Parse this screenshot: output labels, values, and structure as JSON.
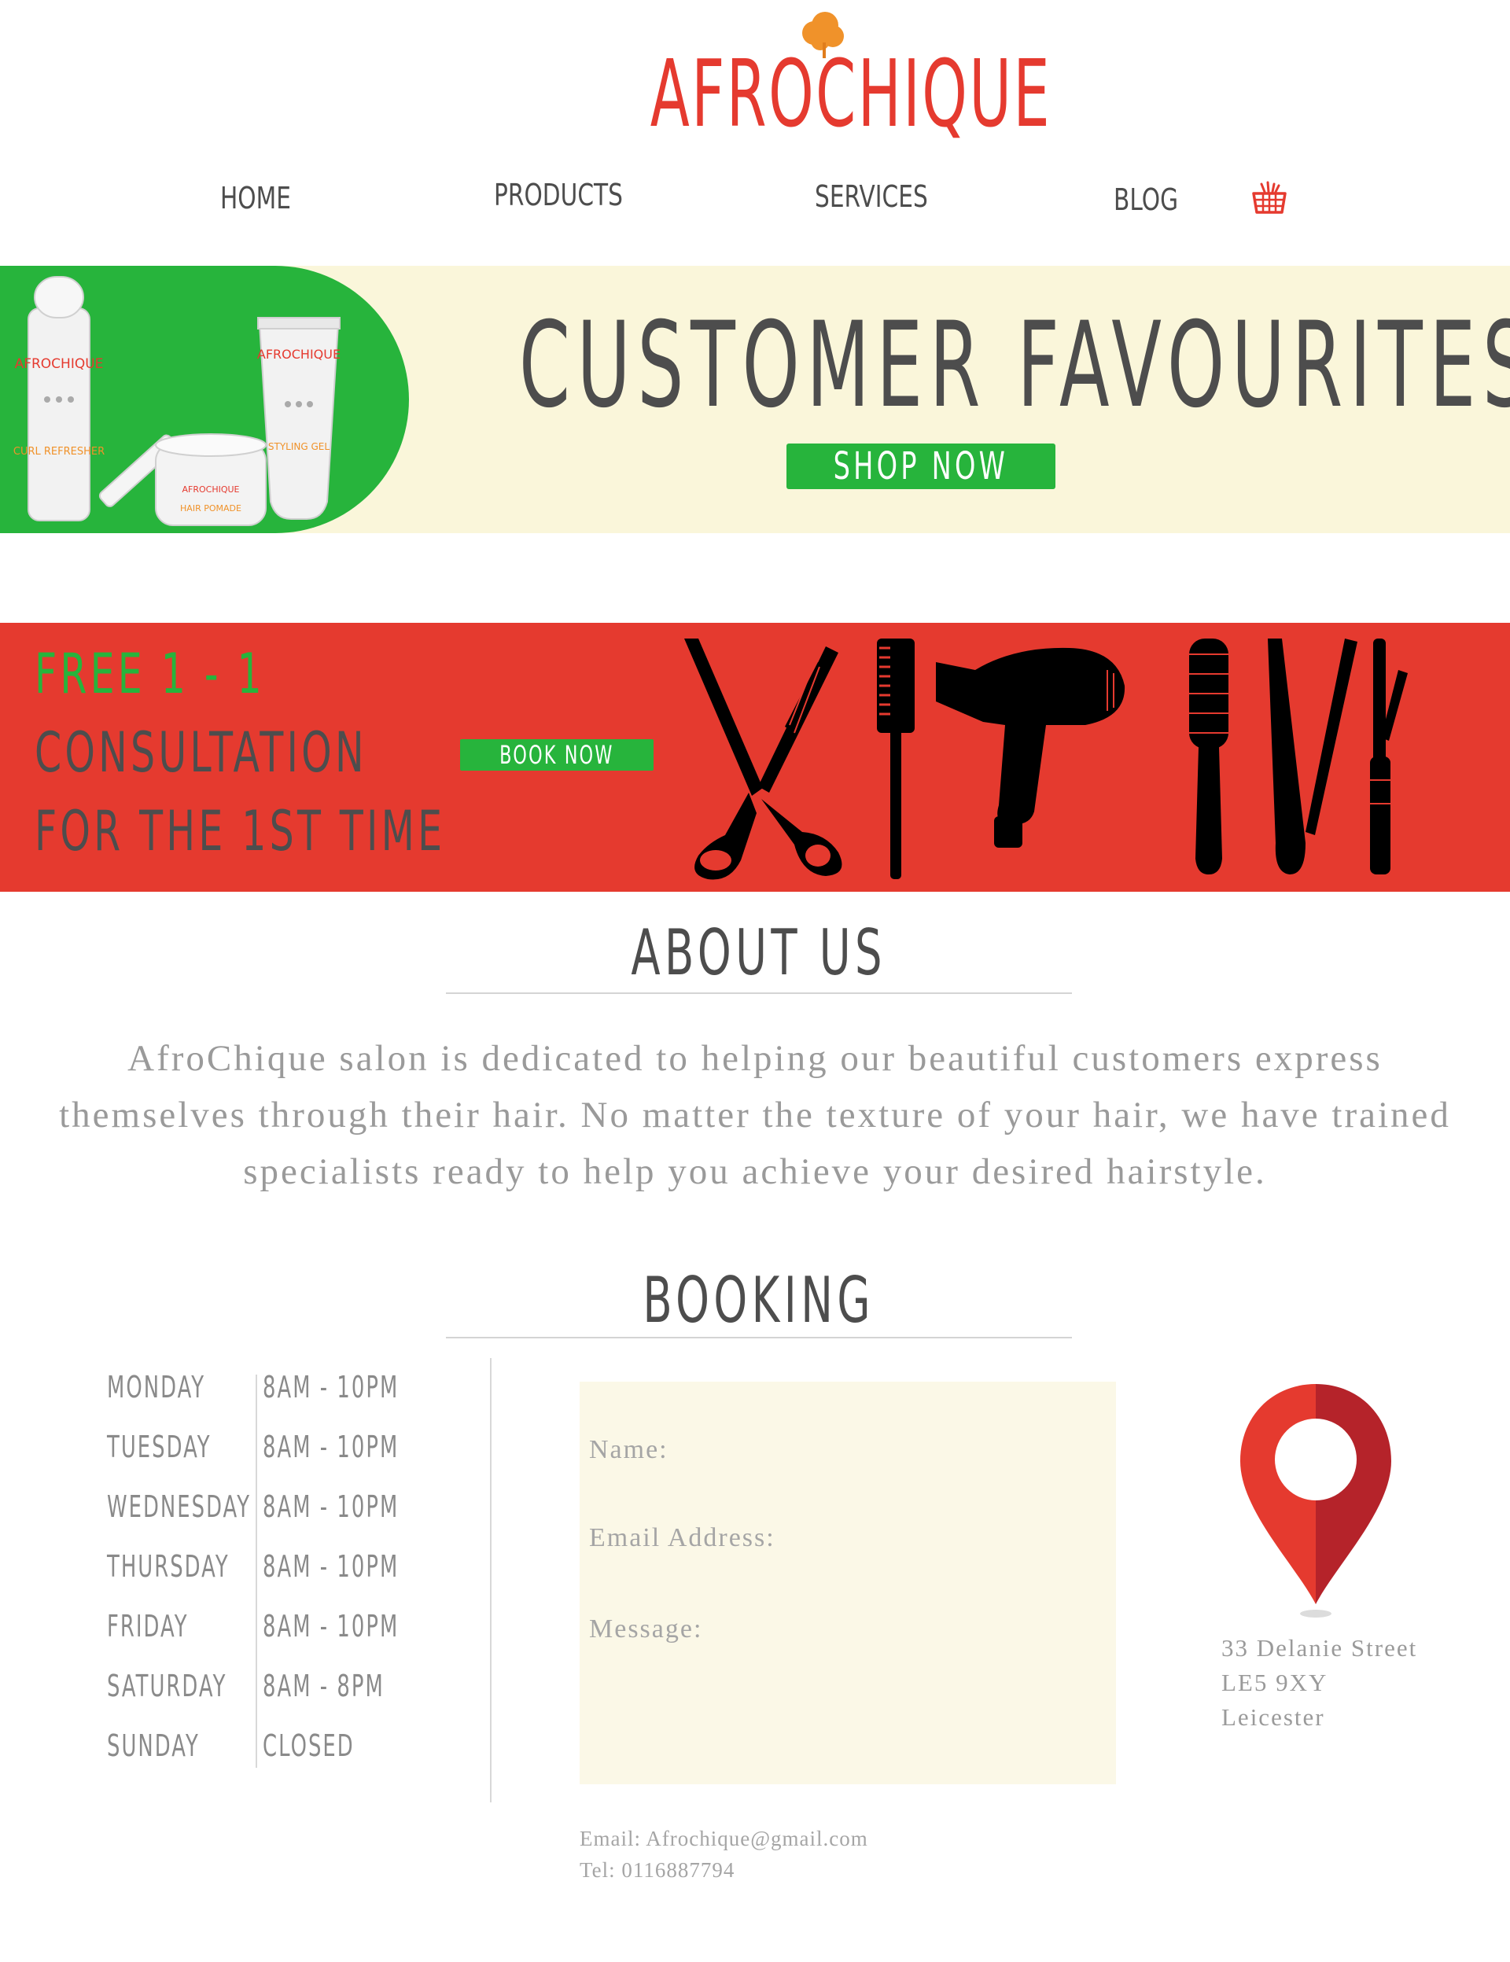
{
  "brand": {
    "name": "AFROCHIQUE",
    "logo_color": "#e53a2f",
    "tree_color": "#f0922a"
  },
  "nav": {
    "items": [
      {
        "label": "HOME"
      },
      {
        "label": "PRODUCTS"
      },
      {
        "label": "SERVICES"
      },
      {
        "label": "BLOG"
      }
    ],
    "cart_icon": "shopping-basket-icon"
  },
  "promo": {
    "title": "CUSTOMER FAVOURITES",
    "button": "SHOP NOW",
    "products": [
      {
        "brand": "AFROCHIQUE",
        "name": "CURL REFRESHER"
      },
      {
        "brand": "AFROCHIQUE",
        "name": "HAIR POMADE"
      },
      {
        "brand": "AFROCHIQUE",
        "name": "STYLING GEL"
      }
    ]
  },
  "consultation": {
    "line1": "FREE 1 - 1",
    "line2": "CONSULTATION",
    "line3": "FOR THE 1ST TIME",
    "button": "BOOK NOW",
    "tools": [
      "scissors-icon",
      "comb-icon",
      "hair-dryer-icon",
      "round-brush-icon",
      "straightener-icon",
      "curling-iron-icon"
    ]
  },
  "about": {
    "title": "ABOUT US",
    "text": "AfroChique salon is dedicated to helping our beautiful customers express themselves through their hair. No matter the texture of your hair,  we have trained specialists ready to help you achieve your desired hairstyle."
  },
  "booking": {
    "title": "BOOKING",
    "hours": [
      {
        "day": "MONDAY",
        "time": "8AM - 10PM"
      },
      {
        "day": "TUESDAY",
        "time": "8AM - 10PM"
      },
      {
        "day": "WEDNESDAY",
        "time": "8AM - 10PM"
      },
      {
        "day": "THURSDAY",
        "time": "8AM - 10PM"
      },
      {
        "day": "FRIDAY",
        "time": "8AM - 10PM"
      },
      {
        "day": "SATURDAY",
        "time": "8AM - 8PM"
      },
      {
        "day": "SUNDAY",
        "time": "CLOSED"
      }
    ],
    "form": {
      "name_label": "Name:",
      "email_label": "Email Address:",
      "message_label": "Message:"
    },
    "contact": {
      "email": "Email: Afrochique@gmail.com",
      "tel": "Tel: 0116887794"
    },
    "address": {
      "line1": "33 Delanie Street",
      "line2": "LE5 9XY",
      "line3": "Leicester"
    },
    "pin_icon": "map-pin-icon"
  },
  "colors": {
    "red": "#e53a2f",
    "green": "#27b43c",
    "cream": "#faf6da",
    "text_dark": "#4d4d4d"
  }
}
